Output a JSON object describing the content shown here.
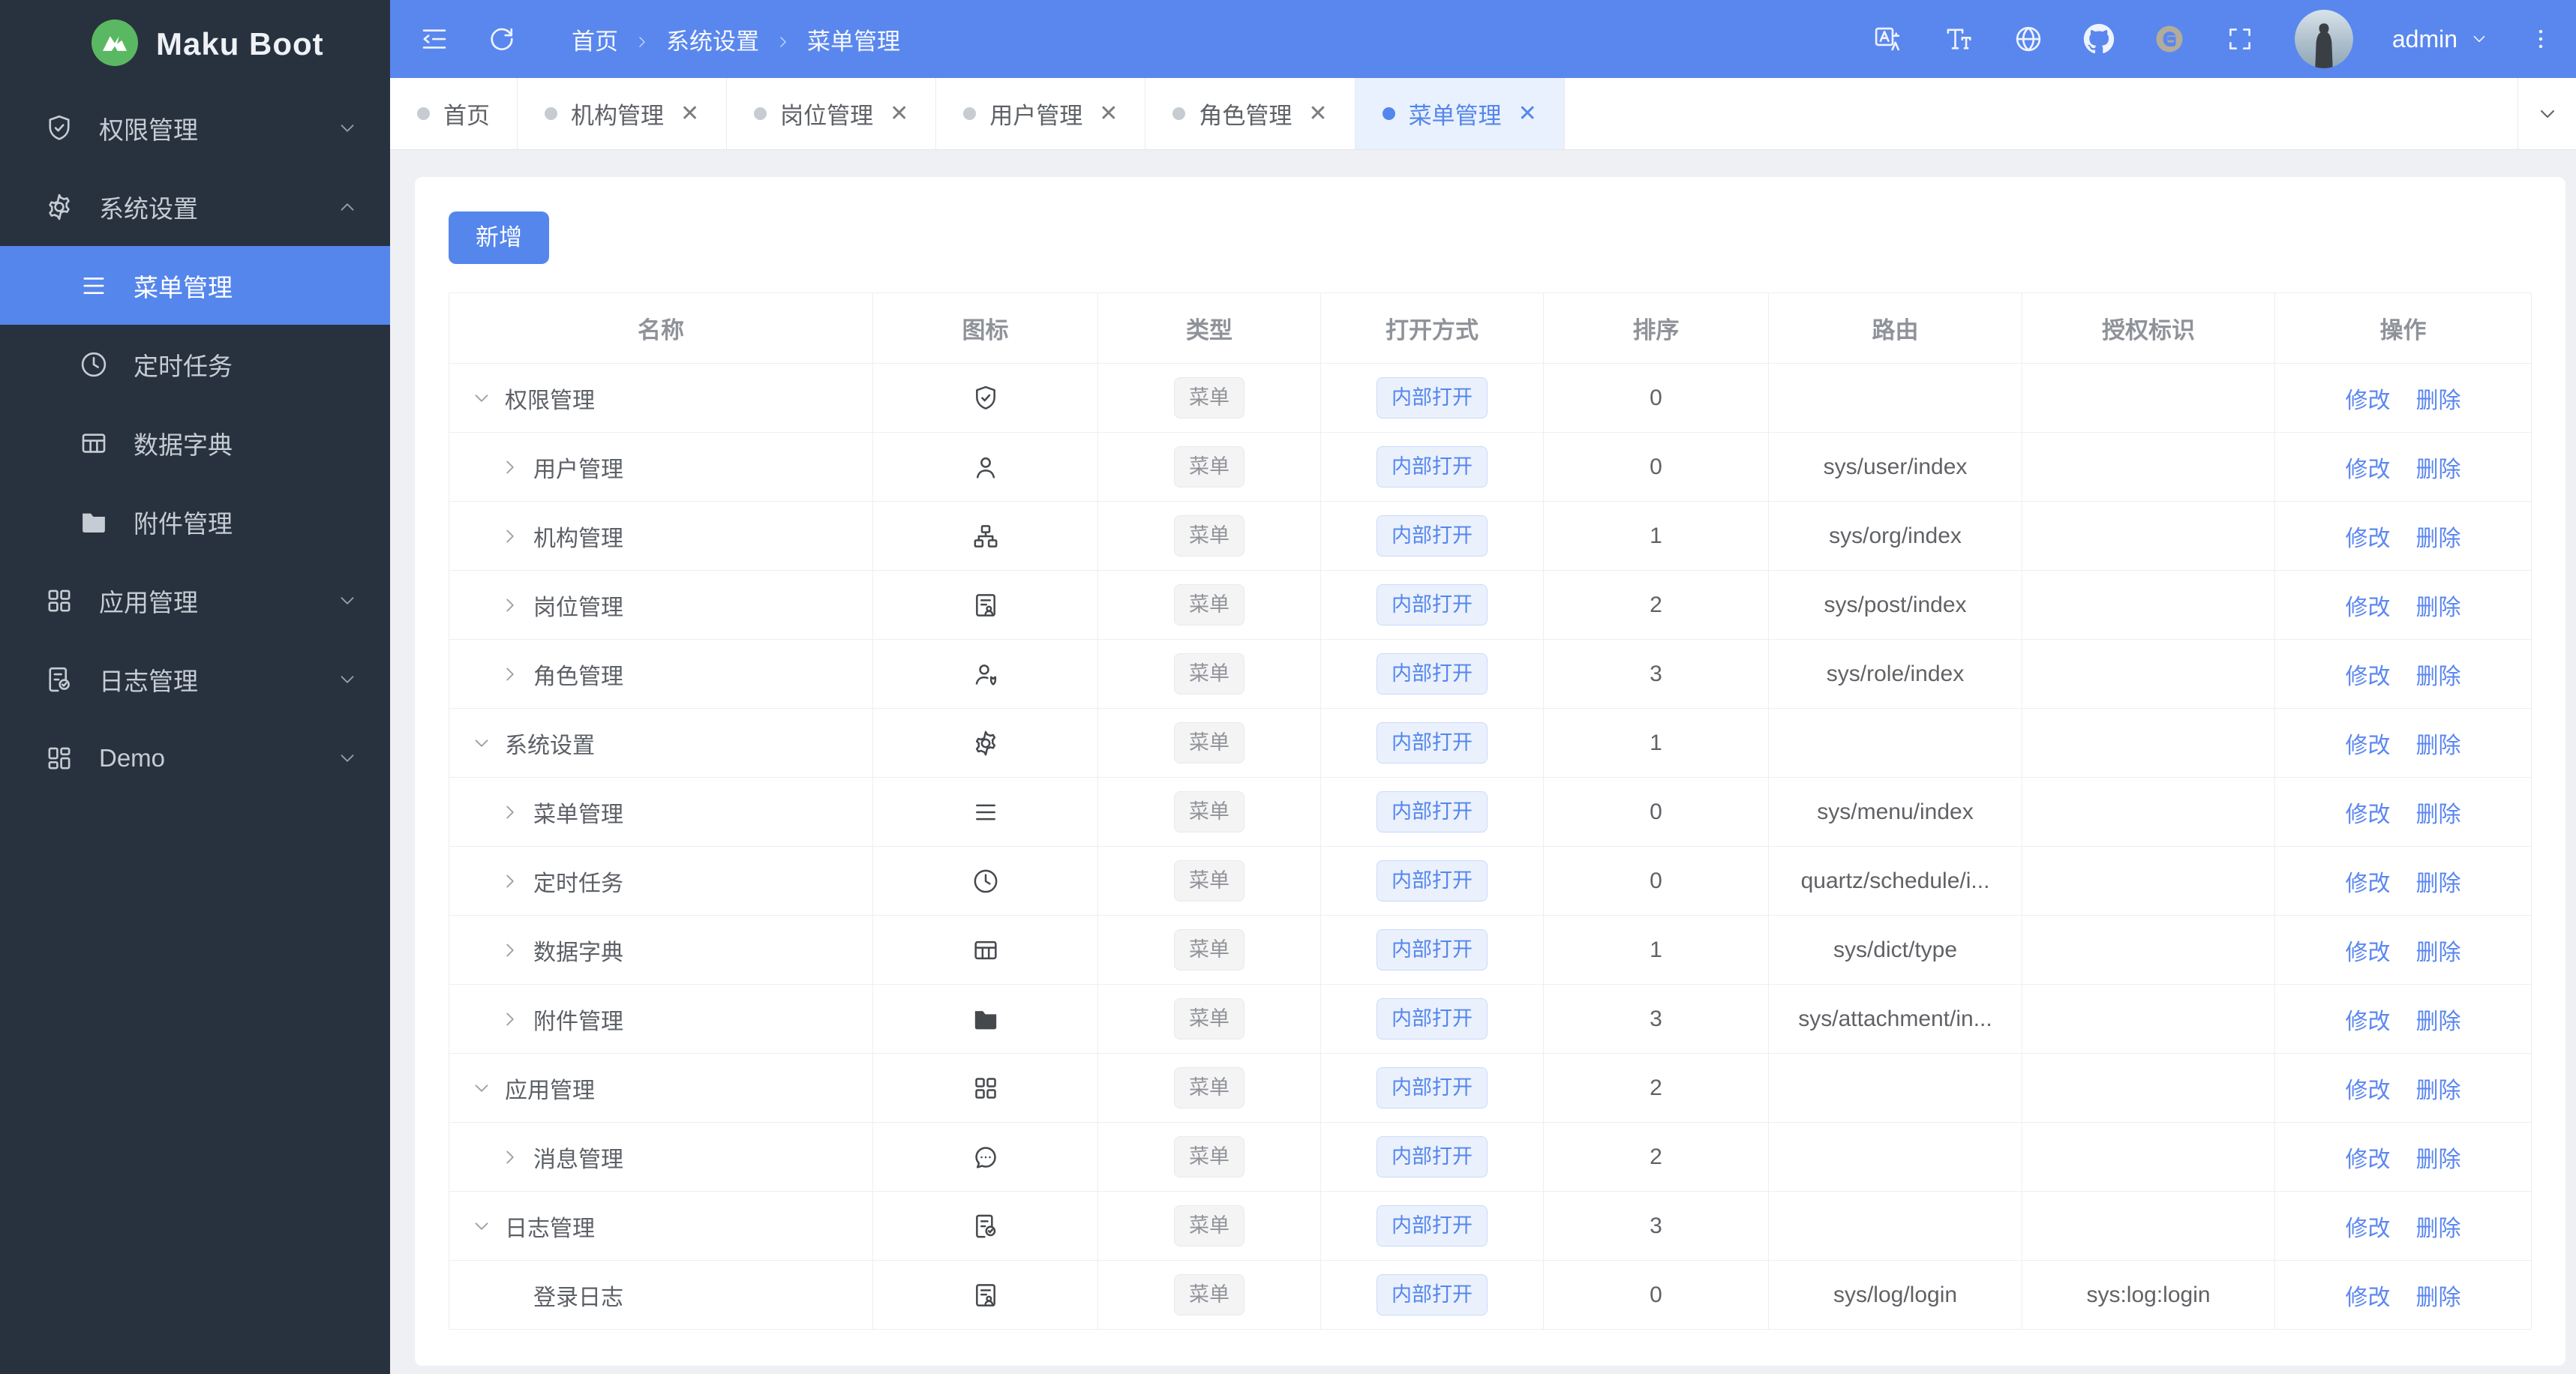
{
  "app": {
    "logo_text": "Maku Boot"
  },
  "colors": {
    "primary": "#5586ec",
    "header_bg": "#5a87ee",
    "sidebar_bg": "#28323e",
    "sidebar_active_bg": "#5586ec",
    "page_bg": "#eef0f4",
    "tab_active_bg": "#e8f1fd",
    "tag_info_text": "#909399",
    "tag_primary_text": "#5586ec",
    "link": "#5b87f0",
    "logo_green": "#5bb862"
  },
  "sidebar": {
    "items": [
      {
        "label": "权限管理",
        "icon": "shield-icon",
        "state": "collapsed",
        "children": []
      },
      {
        "label": "系统设置",
        "icon": "gear-icon",
        "state": "expanded",
        "children": [
          {
            "label": "菜单管理",
            "icon": "menu-icon",
            "active": true
          },
          {
            "label": "定时任务",
            "icon": "clock-icon",
            "active": false
          },
          {
            "label": "数据字典",
            "icon": "table-icon",
            "active": false
          },
          {
            "label": "附件管理",
            "icon": "folder-icon",
            "active": false
          }
        ]
      },
      {
        "label": "应用管理",
        "icon": "grid-icon",
        "state": "collapsed",
        "children": []
      },
      {
        "label": "日志管理",
        "icon": "doc-check-icon",
        "state": "collapsed",
        "children": []
      },
      {
        "label": "Demo",
        "icon": "demo-grid-icon",
        "state": "collapsed",
        "children": []
      }
    ]
  },
  "header": {
    "breadcrumb": [
      "首页",
      "系统设置",
      "菜单管理"
    ],
    "user": "admin",
    "right_icons": [
      "translate-icon",
      "font-size-icon",
      "globe-icon",
      "github-icon",
      "gitee-icon",
      "fullscreen-icon"
    ]
  },
  "tabs": [
    {
      "label": "首页",
      "closable": false,
      "active": false
    },
    {
      "label": "机构管理",
      "closable": true,
      "active": false
    },
    {
      "label": "岗位管理",
      "closable": true,
      "active": false
    },
    {
      "label": "用户管理",
      "closable": true,
      "active": false
    },
    {
      "label": "角色管理",
      "closable": true,
      "active": false
    },
    {
      "label": "菜单管理",
      "closable": true,
      "active": true
    }
  ],
  "toolbar": {
    "add_label": "新增"
  },
  "table": {
    "columns": [
      "名称",
      "图标",
      "类型",
      "打开方式",
      "排序",
      "路由",
      "授权标识",
      "操作"
    ],
    "type_label": "菜单",
    "open_label": "内部打开",
    "edit_label": "修改",
    "delete_label": "删除",
    "rows": [
      {
        "name": "权限管理",
        "chevron": "expanded",
        "level": 0,
        "icon": "shield-icon",
        "sort": "0",
        "route": "",
        "auth": ""
      },
      {
        "name": "用户管理",
        "chevron": "collapsed",
        "level": 1,
        "icon": "user-icon",
        "sort": "0",
        "route": "sys/user/index",
        "auth": ""
      },
      {
        "name": "机构管理",
        "chevron": "collapsed",
        "level": 1,
        "icon": "org-icon",
        "sort": "1",
        "route": "sys/org/index",
        "auth": ""
      },
      {
        "name": "岗位管理",
        "chevron": "collapsed",
        "level": 1,
        "icon": "badge-icon",
        "sort": "2",
        "route": "sys/post/index",
        "auth": ""
      },
      {
        "name": "角色管理",
        "chevron": "collapsed",
        "level": 1,
        "icon": "role-icon",
        "sort": "3",
        "route": "sys/role/index",
        "auth": ""
      },
      {
        "name": "系统设置",
        "chevron": "expanded",
        "level": 0,
        "icon": "gear-icon",
        "sort": "1",
        "route": "",
        "auth": ""
      },
      {
        "name": "菜单管理",
        "chevron": "collapsed",
        "level": 1,
        "icon": "menu-icon",
        "sort": "0",
        "route": "sys/menu/index",
        "auth": ""
      },
      {
        "name": "定时任务",
        "chevron": "collapsed",
        "level": 1,
        "icon": "clock-icon",
        "sort": "0",
        "route": "quartz/schedule/i...",
        "auth": ""
      },
      {
        "name": "数据字典",
        "chevron": "collapsed",
        "level": 1,
        "icon": "table-icon",
        "sort": "1",
        "route": "sys/dict/type",
        "auth": ""
      },
      {
        "name": "附件管理",
        "chevron": "collapsed",
        "level": 1,
        "icon": "folder-icon",
        "sort": "3",
        "route": "sys/attachment/in...",
        "auth": ""
      },
      {
        "name": "应用管理",
        "chevron": "expanded",
        "level": 0,
        "icon": "grid-icon",
        "sort": "2",
        "route": "",
        "auth": ""
      },
      {
        "name": "消息管理",
        "chevron": "collapsed",
        "level": 1,
        "icon": "message-icon",
        "sort": "2",
        "route": "",
        "auth": ""
      },
      {
        "name": "日志管理",
        "chevron": "expanded",
        "level": 0,
        "icon": "doc-check-icon",
        "sort": "3",
        "route": "",
        "auth": ""
      },
      {
        "name": "登录日志",
        "chevron": "none",
        "level": 1,
        "icon": "badge-icon",
        "sort": "0",
        "route": "sys/log/login",
        "auth": "sys:log:login"
      }
    ]
  }
}
